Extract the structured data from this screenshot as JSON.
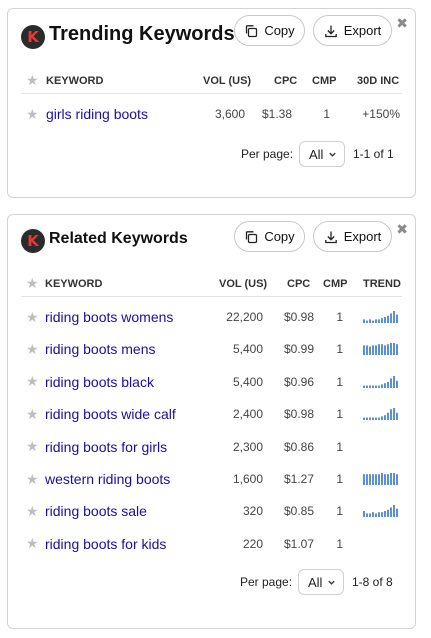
{
  "trending": {
    "title": "Trending Keywords",
    "logo_letter": "K",
    "copy_label": "Copy",
    "export_label": "Export",
    "columns": [
      "KEYWORD",
      "VOL (US)",
      "CPC",
      "CMP",
      "30D INC"
    ],
    "rows": [
      {
        "keyword": "girls riding boots",
        "vol": "3,600",
        "cpc": "$1.38",
        "cmp": "1",
        "inc": "+150%"
      }
    ],
    "per_page_label": "Per page:",
    "per_page_value": "All",
    "range": "1-1 of 1"
  },
  "related": {
    "title": "Related Keywords",
    "logo_letter": "K",
    "copy_label": "Copy",
    "export_label": "Export",
    "columns": [
      "KEYWORD",
      "VOL (US)",
      "CPC",
      "CMP",
      "TREND"
    ],
    "rows": [
      {
        "keyword": "riding boots womens",
        "vol": "22,200",
        "cpc": "$0.98",
        "cmp": "1",
        "trend": [
          0.3,
          0.2,
          0.3,
          0.2,
          0.3,
          0.3,
          0.4,
          0.5,
          0.6,
          0.8,
          1.0,
          0.7
        ]
      },
      {
        "keyword": "riding boots mens",
        "vol": "5,400",
        "cpc": "$0.99",
        "cmp": "1",
        "trend": [
          0.8,
          0.8,
          0.7,
          0.8,
          0.8,
          0.9,
          0.9,
          0.8,
          0.9,
          1.0,
          1.0,
          0.9
        ]
      },
      {
        "keyword": "riding boots black",
        "vol": "5,400",
        "cpc": "$0.96",
        "cmp": "1",
        "trend": [
          0.2,
          0.2,
          0.2,
          0.2,
          0.2,
          0.2,
          0.3,
          0.4,
          0.5,
          0.8,
          1.0,
          0.6
        ]
      },
      {
        "keyword": "riding boots wide calf",
        "vol": "2,400",
        "cpc": "$0.98",
        "cmp": "1",
        "trend": [
          0.2,
          0.2,
          0.2,
          0.2,
          0.2,
          0.2,
          0.3,
          0.4,
          0.6,
          0.9,
          1.0,
          0.6
        ]
      },
      {
        "keyword": "riding boots for girls",
        "vol": "2,300",
        "cpc": "$0.86",
        "cmp": "1",
        "trend": []
      },
      {
        "keyword": "western riding boots",
        "vol": "1,600",
        "cpc": "$1.27",
        "cmp": "1",
        "trend": [
          0.9,
          0.9,
          0.9,
          0.9,
          0.9,
          0.9,
          1.0,
          0.9,
          0.9,
          1.0,
          1.0,
          0.9
        ]
      },
      {
        "keyword": "riding boots sale",
        "vol": "320",
        "cpc": "$0.85",
        "cmp": "1",
        "trend": [
          0.5,
          0.3,
          0.3,
          0.4,
          0.3,
          0.4,
          0.4,
          0.5,
          0.6,
          0.8,
          1.0,
          0.7
        ]
      },
      {
        "keyword": "riding boots for kids",
        "vol": "220",
        "cpc": "$1.07",
        "cmp": "1",
        "trend": []
      }
    ],
    "per_page_label": "Per page:",
    "per_page_value": "All",
    "range": "1-8 of 8"
  },
  "colors": {
    "link": "#1a0dab",
    "trend_bar": "#5b8fd6",
    "logo_bg": "#2b2b2b",
    "logo_letter": "#e53935"
  },
  "icons": [
    "copy-icon",
    "download-icon",
    "close-icon",
    "star-icon",
    "chevron-down-icon"
  ]
}
